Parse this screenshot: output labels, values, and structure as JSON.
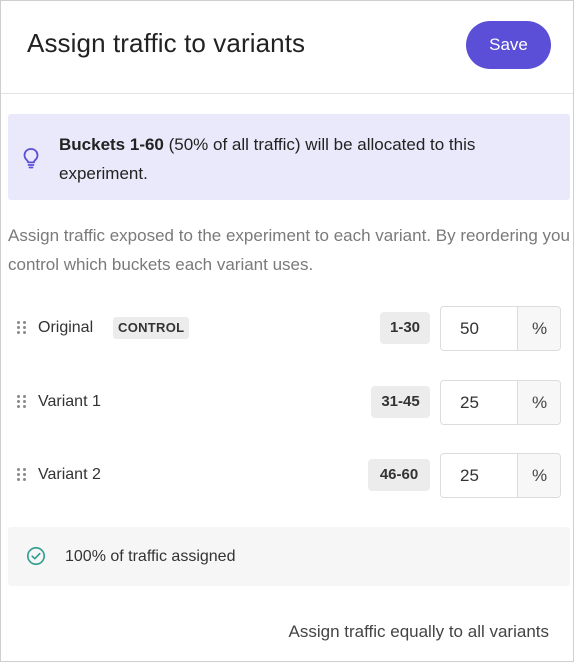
{
  "header": {
    "title": "Assign traffic to variants",
    "save_label": "Save"
  },
  "info": {
    "icon": "lightbulb-icon",
    "bold_text": "Buckets 1-60",
    "rest_text": " (50% of all traffic) will be allocated to this experiment."
  },
  "description": "Assign traffic exposed to the experiment to each variant. By reordering you control which buckets each variant uses.",
  "variants": [
    {
      "name": "Original",
      "badge": "CONTROL",
      "range": "1-30",
      "percent": "50",
      "unit": "%"
    },
    {
      "name": "Variant 1",
      "badge": "",
      "range": "31-45",
      "percent": "25",
      "unit": "%"
    },
    {
      "name": "Variant 2",
      "badge": "",
      "range": "46-60",
      "percent": "25",
      "unit": "%"
    }
  ],
  "status": {
    "icon": "check-circle-icon",
    "text": "100% of traffic assigned"
  },
  "actions": {
    "equal_label": "Assign traffic equally to all variants"
  },
  "colors": {
    "accent": "#5a4fd6",
    "info_bg": "#eae9fb",
    "success": "#2e9c8c"
  }
}
